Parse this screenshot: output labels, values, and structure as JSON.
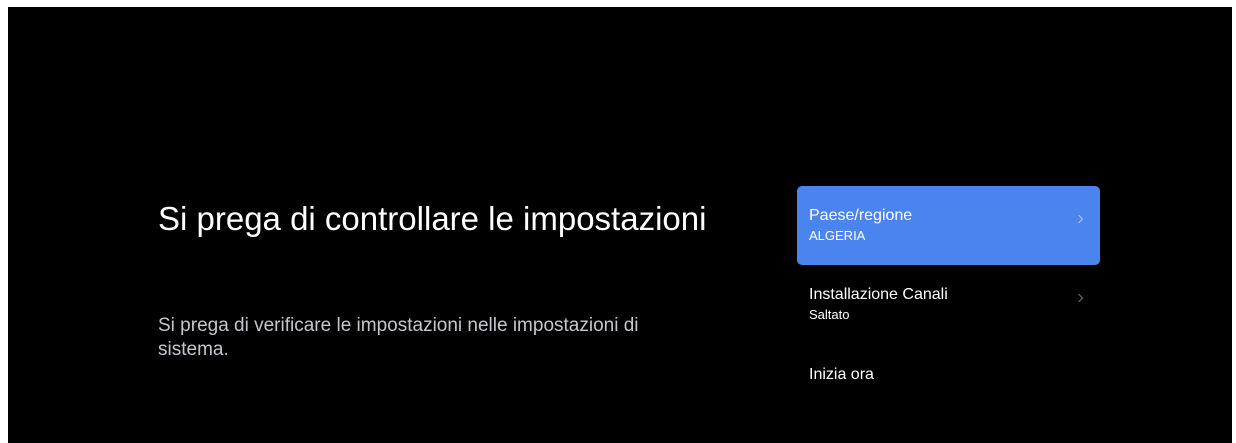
{
  "title": "Si prega di controllare le impostazioni",
  "subtitle": "Si prega di verificare le impostazioni nelle impostazioni di sistema.",
  "menu": {
    "items": [
      {
        "label": "Paese/regione",
        "value": "ALGERIA",
        "icon": "chevron-right-icon",
        "focused": true
      },
      {
        "label": "Installazione Canali",
        "value": "Saltato",
        "icon": "chevron-right-icon",
        "focused": false
      },
      {
        "label": "Inizia ora"
      }
    ]
  },
  "colors": {
    "background": "#000000",
    "focus_highlight": "#4a84ee",
    "text_primary": "#ffffff",
    "text_secondary": "#c4c6cc"
  }
}
